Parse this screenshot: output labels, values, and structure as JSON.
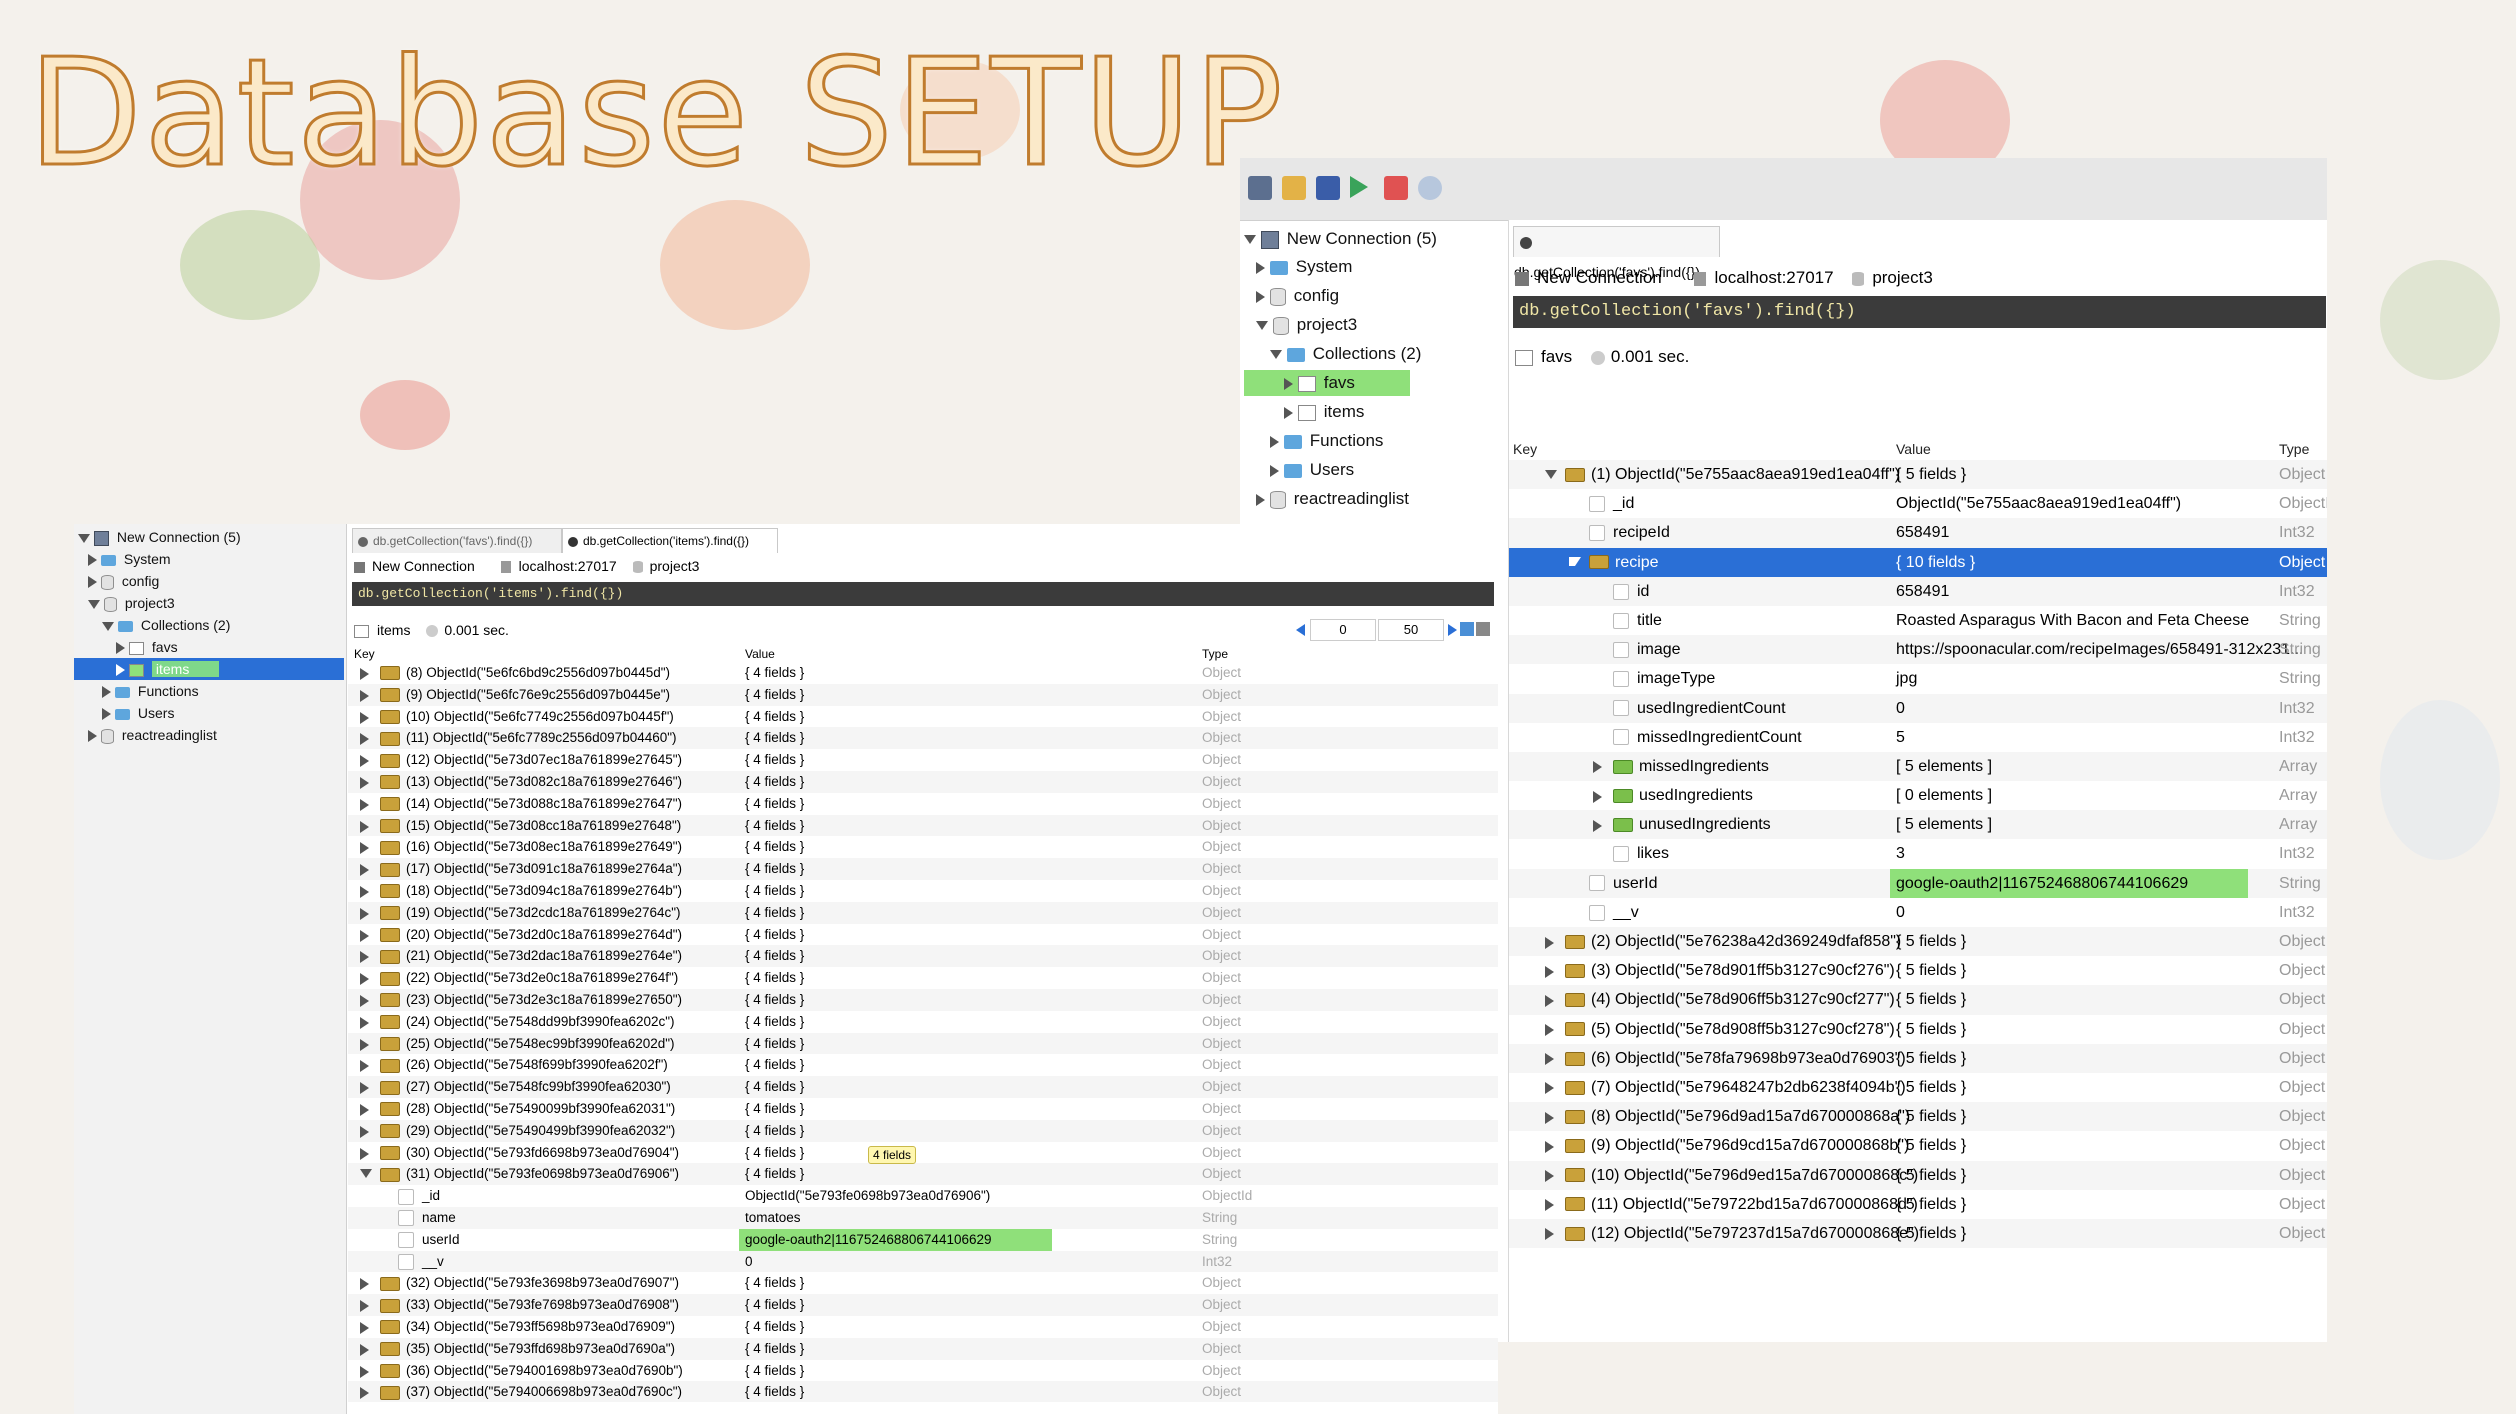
{
  "slide": {
    "title": "Database SETUP"
  },
  "right": {
    "tree": {
      "connection": "New Connection (5)",
      "system": "System",
      "config": "config",
      "project": "project3",
      "collections": "Collections (2)",
      "favs": "favs",
      "items": "items",
      "functions": "Functions",
      "users": "Users",
      "other_db": "reactreadinglist"
    },
    "tab": "db.getCollection('favs').find({})",
    "conn": {
      "name": "New Connection",
      "host": "localhost:27017",
      "db": "project3"
    },
    "query": "db.getCollection('favs').find({})",
    "status": {
      "collection": "favs",
      "time": "0.001 sec."
    },
    "headers": {
      "key": "Key",
      "value": "Value",
      "type": "Type"
    },
    "rows": [
      {
        "key": "(1) ObjectId(\"5e755aac8aea919ed1ea04ff\")",
        "value": "{ 5 fields }",
        "type": "Object"
      },
      {
        "key": "_id",
        "value": "ObjectId(\"5e755aac8aea919ed1ea04ff\")",
        "type": "ObjectId"
      },
      {
        "key": "recipeId",
        "value": "658491",
        "type": "Int32"
      },
      {
        "key": "recipe",
        "value": "{ 10 fields }",
        "type": "Object"
      },
      {
        "key": "id",
        "value": "658491",
        "type": "Int32"
      },
      {
        "key": "title",
        "value": "Roasted Asparagus With Bacon and Feta Cheese",
        "type": "String"
      },
      {
        "key": "image",
        "value": "https://spoonacular.com/recipeImages/658491-312x231...",
        "type": "String"
      },
      {
        "key": "imageType",
        "value": "jpg",
        "type": "String"
      },
      {
        "key": "usedIngredientCount",
        "value": "0",
        "type": "Int32"
      },
      {
        "key": "missedIngredientCount",
        "value": "5",
        "type": "Int32"
      },
      {
        "key": "missedIngredients",
        "value": "[ 5 elements ]",
        "type": "Array"
      },
      {
        "key": "usedIngredients",
        "value": "[ 0 elements ]",
        "type": "Array"
      },
      {
        "key": "unusedIngredients",
        "value": "[ 5 elements ]",
        "type": "Array"
      },
      {
        "key": "likes",
        "value": "3",
        "type": "Int32"
      },
      {
        "key": "userId",
        "value": "google-oauth2|116752468806744106629",
        "type": "String"
      },
      {
        "key": "__v",
        "value": "0",
        "type": "Int32"
      },
      {
        "key": "(2) ObjectId(\"5e76238a42d369249dfaf858\")",
        "value": "{ 5 fields }",
        "type": "Object"
      },
      {
        "key": "(3) ObjectId(\"5e78d901ff5b3127c90cf276\")",
        "value": "{ 5 fields }",
        "type": "Object"
      },
      {
        "key": "(4) ObjectId(\"5e78d906ff5b3127c90cf277\")",
        "value": "{ 5 fields }",
        "type": "Object"
      },
      {
        "key": "(5) ObjectId(\"5e78d908ff5b3127c90cf278\")",
        "value": "{ 5 fields }",
        "type": "Object"
      },
      {
        "key": "(6) ObjectId(\"5e78fa79698b973ea0d76903\")",
        "value": "{ 5 fields }",
        "type": "Object"
      },
      {
        "key": "(7) ObjectId(\"5e79648247b2db6238f4094b\")",
        "value": "{ 5 fields }",
        "type": "Object"
      },
      {
        "key": "(8) ObjectId(\"5e796d9ad15a7d670000868a\")",
        "value": "{ 5 fields }",
        "type": "Object"
      },
      {
        "key": "(9) ObjectId(\"5e796d9cd15a7d670000868b\")",
        "value": "{ 5 fields }",
        "type": "Object"
      },
      {
        "key": "(10) ObjectId(\"5e796d9ed15a7d670000868c\")",
        "value": "{ 5 fields }",
        "type": "Object"
      },
      {
        "key": "(11) ObjectId(\"5e79722bd15a7d670000868d\")",
        "value": "{ 5 fields }",
        "type": "Object"
      },
      {
        "key": "(12) ObjectId(\"5e797237d15a7d670000868e\")",
        "value": "{ 5 fields }",
        "type": "Object"
      }
    ]
  },
  "left": {
    "tree": {
      "connection": "New Connection (5)",
      "system": "System",
      "config": "config",
      "project": "project3",
      "collections": "Collections (2)",
      "favs": "favs",
      "items": "items",
      "functions": "Functions",
      "users": "Users",
      "other_db": "reactreadinglist"
    },
    "tabs": [
      "db.getCollection('favs').find({})",
      "db.getCollection('items').find({})"
    ],
    "conn": {
      "name": "New Connection",
      "host": "localhost:27017",
      "db": "project3"
    },
    "query": "db.getCollection('items').find({})",
    "status": {
      "collection": "items",
      "time": "0.001 sec.",
      "skip": "0",
      "limit": "50"
    },
    "headers": {
      "key": "Key",
      "value": "Value",
      "type": "Type"
    },
    "tooltip": "4 fields",
    "rows": [
      {
        "key": "(8) ObjectId(\"5e6fc6bd9c2556d097b0445d\")",
        "value": "{ 4 fields }",
        "type": "Object"
      },
      {
        "key": "(9) ObjectId(\"5e6fc76e9c2556d097b0445e\")",
        "value": "{ 4 fields }",
        "type": "Object"
      },
      {
        "key": "(10) ObjectId(\"5e6fc7749c2556d097b0445f\")",
        "value": "{ 4 fields }",
        "type": "Object"
      },
      {
        "key": "(11) ObjectId(\"5e6fc7789c2556d097b04460\")",
        "value": "{ 4 fields }",
        "type": "Object"
      },
      {
        "key": "(12) ObjectId(\"5e73d07ec18a761899e27645\")",
        "value": "{ 4 fields }",
        "type": "Object"
      },
      {
        "key": "(13) ObjectId(\"5e73d082c18a761899e27646\")",
        "value": "{ 4 fields }",
        "type": "Object"
      },
      {
        "key": "(14) ObjectId(\"5e73d088c18a761899e27647\")",
        "value": "{ 4 fields }",
        "type": "Object"
      },
      {
        "key": "(15) ObjectId(\"5e73d08cc18a761899e27648\")",
        "value": "{ 4 fields }",
        "type": "Object"
      },
      {
        "key": "(16) ObjectId(\"5e73d08ec18a761899e27649\")",
        "value": "{ 4 fields }",
        "type": "Object"
      },
      {
        "key": "(17) ObjectId(\"5e73d091c18a761899e2764a\")",
        "value": "{ 4 fields }",
        "type": "Object"
      },
      {
        "key": "(18) ObjectId(\"5e73d094c18a761899e2764b\")",
        "value": "{ 4 fields }",
        "type": "Object"
      },
      {
        "key": "(19) ObjectId(\"5e73d2cdc18a761899e2764c\")",
        "value": "{ 4 fields }",
        "type": "Object"
      },
      {
        "key": "(20) ObjectId(\"5e73d2d0c18a761899e2764d\")",
        "value": "{ 4 fields }",
        "type": "Object"
      },
      {
        "key": "(21) ObjectId(\"5e73d2dac18a761899e2764e\")",
        "value": "{ 4 fields }",
        "type": "Object"
      },
      {
        "key": "(22) ObjectId(\"5e73d2e0c18a761899e2764f\")",
        "value": "{ 4 fields }",
        "type": "Object"
      },
      {
        "key": "(23) ObjectId(\"5e73d2e3c18a761899e27650\")",
        "value": "{ 4 fields }",
        "type": "Object"
      },
      {
        "key": "(24) ObjectId(\"5e7548dd99bf3990fea6202c\")",
        "value": "{ 4 fields }",
        "type": "Object"
      },
      {
        "key": "(25) ObjectId(\"5e7548ec99bf3990fea6202d\")",
        "value": "{ 4 fields }",
        "type": "Object"
      },
      {
        "key": "(26) ObjectId(\"5e7548f699bf3990fea6202f\")",
        "value": "{ 4 fields }",
        "type": "Object"
      },
      {
        "key": "(27) ObjectId(\"5e7548fc99bf3990fea62030\")",
        "value": "{ 4 fields }",
        "type": "Object"
      },
      {
        "key": "(28) ObjectId(\"5e75490099bf3990fea62031\")",
        "value": "{ 4 fields }",
        "type": "Object"
      },
      {
        "key": "(29) ObjectId(\"5e75490499bf3990fea62032\")",
        "value": "{ 4 fields }",
        "type": "Object"
      },
      {
        "key": "(30) ObjectId(\"5e793fd6698b973ea0d76904\")",
        "value": "{ 4 fields }",
        "type": "Object"
      },
      {
        "key": "(31) ObjectId(\"5e793fe0698b973ea0d76906\")",
        "value": "{ 4 fields }",
        "type": "Object"
      },
      {
        "key": "_id",
        "value": "ObjectId(\"5e793fe0698b973ea0d76906\")",
        "type": "ObjectId"
      },
      {
        "key": "name",
        "value": "tomatoes",
        "type": "String"
      },
      {
        "key": "userId",
        "value": "google-oauth2|116752468806744106629",
        "type": "String"
      },
      {
        "key": "__v",
        "value": "0",
        "type": "Int32"
      },
      {
        "key": "(32) ObjectId(\"5e793fe3698b973ea0d76907\")",
        "value": "{ 4 fields }",
        "type": "Object"
      },
      {
        "key": "(33) ObjectId(\"5e793fe7698b973ea0d76908\")",
        "value": "{ 4 fields }",
        "type": "Object"
      },
      {
        "key": "(34) ObjectId(\"5e793ff5698b973ea0d76909\")",
        "value": "{ 4 fields }",
        "type": "Object"
      },
      {
        "key": "(35) ObjectId(\"5e793ffd698b973ea0d7690a\")",
        "value": "{ 4 fields }",
        "type": "Object"
      },
      {
        "key": "(36) ObjectId(\"5e794001698b973ea0d7690b\")",
        "value": "{ 4 fields }",
        "type": "Object"
      },
      {
        "key": "(37) ObjectId(\"5e794006698b973ea0d7690c\")",
        "value": "{ 4 fields }",
        "type": "Object"
      }
    ]
  }
}
